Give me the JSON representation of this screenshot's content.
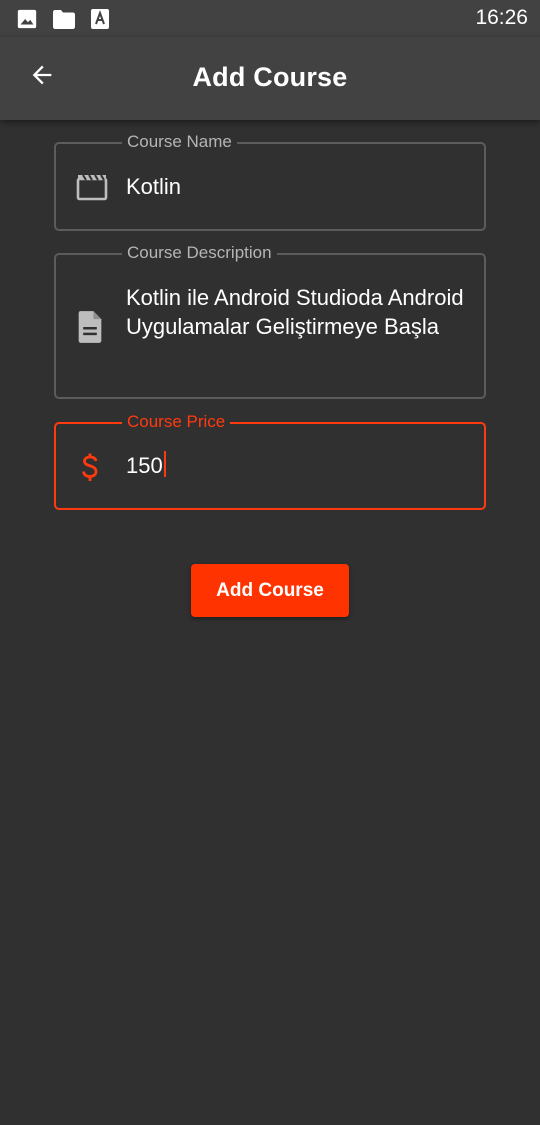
{
  "status_bar": {
    "time": "16:26",
    "icons": [
      "image-icon",
      "sd-card-icon",
      "font-download-icon"
    ]
  },
  "app_bar": {
    "title": "Add Course",
    "back_icon": "arrow-back-icon"
  },
  "form": {
    "course_name": {
      "label": "Course Name",
      "value": "Kotlin",
      "icon": "movie-icon"
    },
    "course_description": {
      "label": "Course Description",
      "value": "Kotlin ile Android Studioda Android Uygulamalar Geliştirmeye Başla",
      "icon": "document-icon"
    },
    "course_price": {
      "label": "Course Price",
      "value": "150",
      "icon": "dollar-icon",
      "focused": true
    }
  },
  "submit_button": {
    "label": "Add Course"
  },
  "colors": {
    "background": "#303030",
    "app_bar": "#424242",
    "accent": "#ff3300",
    "outline": "#5c5c5c",
    "label": "#b5b5b5",
    "text": "#ffffff"
  }
}
